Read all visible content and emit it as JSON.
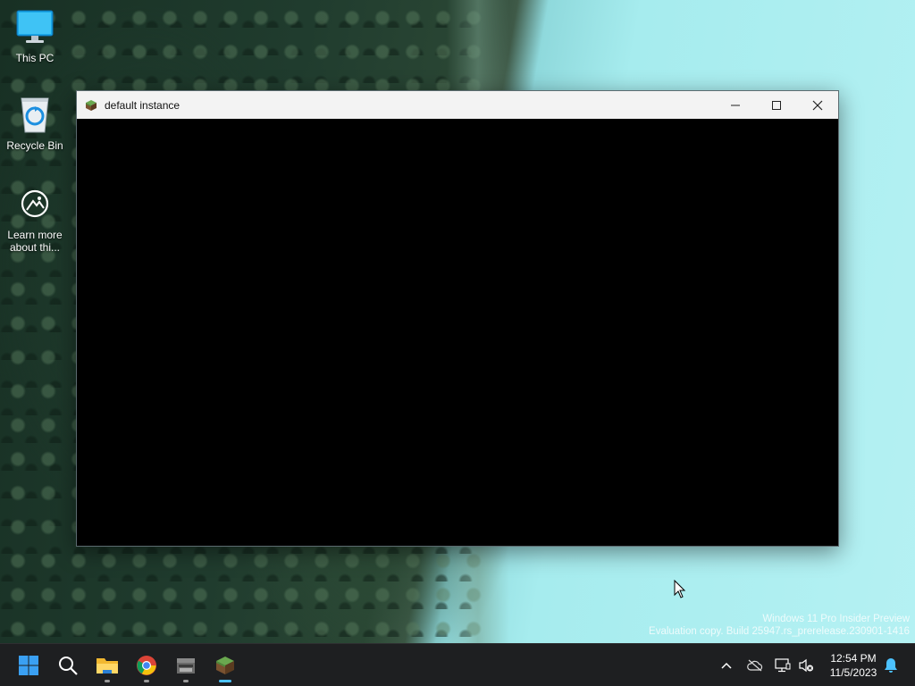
{
  "desktop": {
    "icons": [
      {
        "label": "This PC",
        "icon": "this-pc-icon"
      },
      {
        "label": "Recycle Bin",
        "icon": "recycle-bin-icon"
      },
      {
        "label": "Learn more about thi...",
        "icon": "learn-more-icon"
      }
    ],
    "watermark": {
      "line1": "Windows 11 Pro Insider Preview",
      "line2": "Evaluation copy. Build 25947.rs_prerelease.230901-1416"
    }
  },
  "window": {
    "title": "default instance",
    "icon": "minecraft-grass-block-icon",
    "controls": [
      "minimize-icon",
      "maximize-icon",
      "close-icon"
    ]
  },
  "taskbar": {
    "apps": [
      {
        "name": "start-button",
        "icon": "windows-logo-icon"
      },
      {
        "name": "search-button",
        "icon": "search-icon"
      },
      {
        "name": "file-explorer",
        "icon": "folder-icon",
        "running": true
      },
      {
        "name": "chrome",
        "icon": "chrome-icon",
        "running": true
      },
      {
        "name": "minecraft-launcher",
        "icon": "minecraft-launcher-icon",
        "running": true
      },
      {
        "name": "minecraft",
        "icon": "minecraft-grass-block-icon",
        "running": true,
        "active": true
      }
    ],
    "tray": [
      "chevron-up-icon",
      "onedrive-offline-icon",
      "network-icon",
      "volume-muted-icon",
      "notification-bell-icon"
    ],
    "clock": {
      "time": "12:54 PM",
      "date": "11/5/2023"
    }
  },
  "colors": {
    "accent": "#4cc2ff",
    "taskbar": "#1e1f21",
    "titlebar": "#f3f3f3"
  }
}
